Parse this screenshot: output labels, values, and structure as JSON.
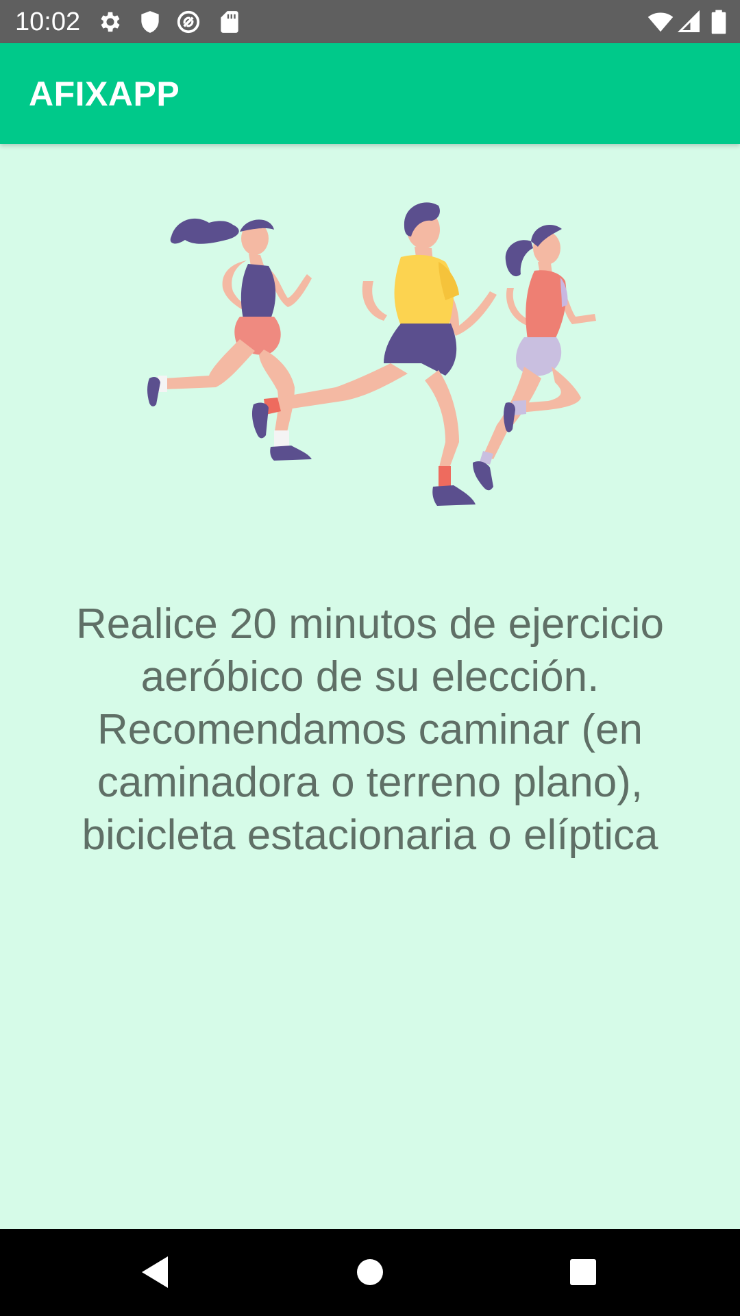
{
  "status_bar": {
    "time": "10:02",
    "left_icons": [
      "gear-icon",
      "shield-icon",
      "no-sync-icon",
      "sd-card-icon"
    ],
    "right_icons": [
      "wifi-icon",
      "signal-icon",
      "battery-icon"
    ]
  },
  "app_bar": {
    "title": "AFIXAPP",
    "color": "#00c98a"
  },
  "content": {
    "background_color": "#d6fbe8",
    "illustration": "three-runners-illustration",
    "instruction_text": "Realice 20 minutos de ejercicio aeróbico de su elección. Recomendamos caminar (en caminadora o terreno plano), bicicleta estacionaria o elíptica"
  },
  "nav_bar": {
    "buttons": [
      "back-icon",
      "home-icon",
      "recents-icon"
    ]
  }
}
